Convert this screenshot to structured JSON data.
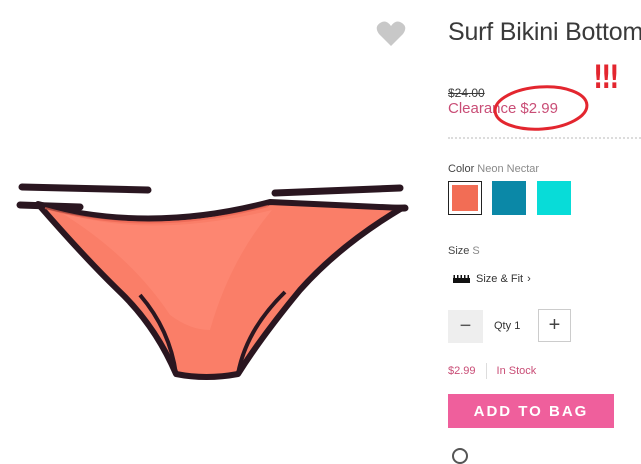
{
  "product": {
    "title": "Surf Bikini Bottom",
    "old_price": "$24.00",
    "clearance_label": "Clearance",
    "clearance_price": "$2.99"
  },
  "annotation": {
    "marks": "!!!",
    "color": "#e3262f"
  },
  "color": {
    "label": "Color",
    "selected": "Neon Nectar",
    "swatches": [
      {
        "name": "Neon Nectar",
        "hex": "#f26d55",
        "selected": true
      },
      {
        "name": "teal",
        "hex": "#0b88a7",
        "selected": false
      },
      {
        "name": "aqua",
        "hex": "#08dcd8",
        "selected": false
      }
    ]
  },
  "size": {
    "label": "Size",
    "selected": "S",
    "size_fit_link": "Size & Fit"
  },
  "quantity": {
    "label": "Qty",
    "value": "1",
    "minus": "−",
    "plus": "+"
  },
  "stock": {
    "price": "$2.99",
    "status": "In Stock"
  },
  "cta": {
    "add_to_bag": "ADD TO BAG",
    "color": "#ef5f9c"
  },
  "accent": "#c94d76",
  "icons": {
    "wishlist": "heart-icon",
    "size_fit": "ruler-icon",
    "chevron": "chevron-right-icon"
  }
}
